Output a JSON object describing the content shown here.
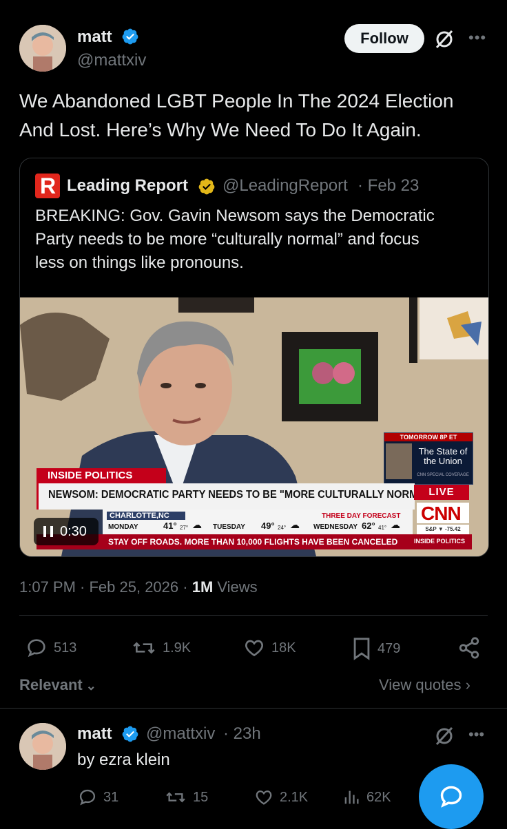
{
  "post": {
    "author_name": "matt",
    "author_handle": "@mattxiv",
    "follow_label": "Follow",
    "text_line1": "We Abandoned LGBT People In The 2024 Election",
    "text_line2": "And Lost. Here’s Why We Need To Do It Again.",
    "timestamp": "1:07 PM · Feb 25, 2026 · ",
    "views_count": "1M",
    "views_label": " Views"
  },
  "quote": {
    "author_name": "Leading Report",
    "author_handle": "@LeadingReport",
    "date": "· Feb 23",
    "text_line1": "BREAKING: Gov. Gavin Newsom says the Democratic",
    "text_line2": "Party needs to be more “culturally normal” and focus",
    "text_line3": "less on things like pronouns.",
    "logo_letter": "R"
  },
  "video": {
    "duration": "0:30",
    "promo_top": "TOMORROW 8P ET",
    "promo_title": "The State of the Union",
    "promo_sub": "CNN SPECIAL COVERAGE",
    "section_label": "INSIDE POLITICS",
    "headline": "NEWSOM: DEMOCRATIC PARTY NEEDS TO BE \"MORE CULTURALLY NORMAL\"",
    "live_label": "LIVE",
    "city": "CHARLOTTE,NC",
    "forecast_label": "THREE DAY FORECAST",
    "day1": "MONDAY",
    "day1_hi": "41°",
    "day1_lo": "27°",
    "day2": "TUESDAY",
    "day2_hi": "49°",
    "day2_lo": "24°",
    "day3": "WEDNESDAY",
    "day3_hi": "62°",
    "day3_lo": "41°",
    "ticker": "STAY OFF ROADS. MORE THAN 10,000 FLIGHTS HAVE BEEN CANCELED",
    "ticker_tag": "INSIDE POLITICS",
    "brand": "CNN",
    "market": "S&P ▼ -75.42"
  },
  "actions": {
    "replies": "513",
    "reposts": "1.9K",
    "likes": "18K",
    "bookmarks": "479"
  },
  "sort": {
    "relevant_label": "Relevant",
    "view_quotes_label": "View quotes"
  },
  "reply": {
    "author_name": "matt",
    "author_handle": "@mattxiv",
    "time": "· 23h",
    "text": "by ezra klein",
    "replies": "31",
    "reposts": "15",
    "likes": "2.1K",
    "views": "62K"
  },
  "colors": {
    "accent": "#1d9bf0",
    "background": "#000000",
    "muted": "#71767b",
    "cnn_red": "#cc0000"
  }
}
